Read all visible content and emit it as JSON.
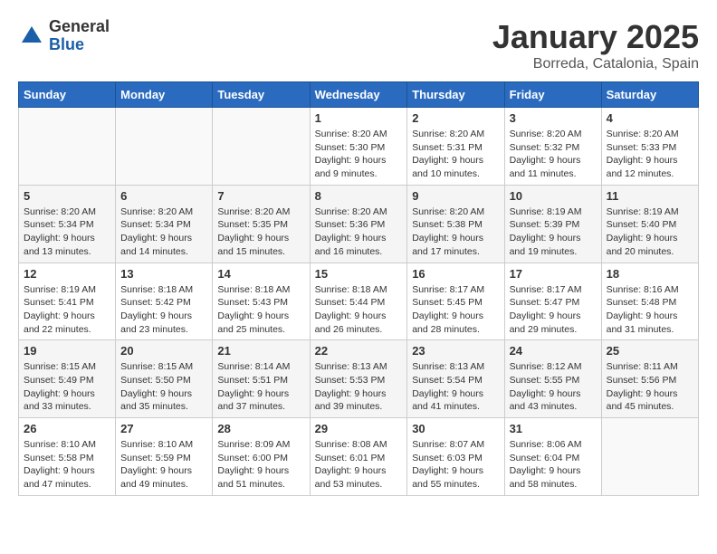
{
  "header": {
    "logo_general": "General",
    "logo_blue": "Blue",
    "month_year": "January 2025",
    "location": "Borreda, Catalonia, Spain"
  },
  "days_of_week": [
    "Sunday",
    "Monday",
    "Tuesday",
    "Wednesday",
    "Thursday",
    "Friday",
    "Saturday"
  ],
  "weeks": [
    [
      {
        "day": "",
        "sunrise": "",
        "sunset": "",
        "daylight": ""
      },
      {
        "day": "",
        "sunrise": "",
        "sunset": "",
        "daylight": ""
      },
      {
        "day": "",
        "sunrise": "",
        "sunset": "",
        "daylight": ""
      },
      {
        "day": "1",
        "sunrise": "Sunrise: 8:20 AM",
        "sunset": "Sunset: 5:30 PM",
        "daylight": "Daylight: 9 hours and 9 minutes."
      },
      {
        "day": "2",
        "sunrise": "Sunrise: 8:20 AM",
        "sunset": "Sunset: 5:31 PM",
        "daylight": "Daylight: 9 hours and 10 minutes."
      },
      {
        "day": "3",
        "sunrise": "Sunrise: 8:20 AM",
        "sunset": "Sunset: 5:32 PM",
        "daylight": "Daylight: 9 hours and 11 minutes."
      },
      {
        "day": "4",
        "sunrise": "Sunrise: 8:20 AM",
        "sunset": "Sunset: 5:33 PM",
        "daylight": "Daylight: 9 hours and 12 minutes."
      }
    ],
    [
      {
        "day": "5",
        "sunrise": "Sunrise: 8:20 AM",
        "sunset": "Sunset: 5:34 PM",
        "daylight": "Daylight: 9 hours and 13 minutes."
      },
      {
        "day": "6",
        "sunrise": "Sunrise: 8:20 AM",
        "sunset": "Sunset: 5:34 PM",
        "daylight": "Daylight: 9 hours and 14 minutes."
      },
      {
        "day": "7",
        "sunrise": "Sunrise: 8:20 AM",
        "sunset": "Sunset: 5:35 PM",
        "daylight": "Daylight: 9 hours and 15 minutes."
      },
      {
        "day": "8",
        "sunrise": "Sunrise: 8:20 AM",
        "sunset": "Sunset: 5:36 PM",
        "daylight": "Daylight: 9 hours and 16 minutes."
      },
      {
        "day": "9",
        "sunrise": "Sunrise: 8:20 AM",
        "sunset": "Sunset: 5:38 PM",
        "daylight": "Daylight: 9 hours and 17 minutes."
      },
      {
        "day": "10",
        "sunrise": "Sunrise: 8:19 AM",
        "sunset": "Sunset: 5:39 PM",
        "daylight": "Daylight: 9 hours and 19 minutes."
      },
      {
        "day": "11",
        "sunrise": "Sunrise: 8:19 AM",
        "sunset": "Sunset: 5:40 PM",
        "daylight": "Daylight: 9 hours and 20 minutes."
      }
    ],
    [
      {
        "day": "12",
        "sunrise": "Sunrise: 8:19 AM",
        "sunset": "Sunset: 5:41 PM",
        "daylight": "Daylight: 9 hours and 22 minutes."
      },
      {
        "day": "13",
        "sunrise": "Sunrise: 8:18 AM",
        "sunset": "Sunset: 5:42 PM",
        "daylight": "Daylight: 9 hours and 23 minutes."
      },
      {
        "day": "14",
        "sunrise": "Sunrise: 8:18 AM",
        "sunset": "Sunset: 5:43 PM",
        "daylight": "Daylight: 9 hours and 25 minutes."
      },
      {
        "day": "15",
        "sunrise": "Sunrise: 8:18 AM",
        "sunset": "Sunset: 5:44 PM",
        "daylight": "Daylight: 9 hours and 26 minutes."
      },
      {
        "day": "16",
        "sunrise": "Sunrise: 8:17 AM",
        "sunset": "Sunset: 5:45 PM",
        "daylight": "Daylight: 9 hours and 28 minutes."
      },
      {
        "day": "17",
        "sunrise": "Sunrise: 8:17 AM",
        "sunset": "Sunset: 5:47 PM",
        "daylight": "Daylight: 9 hours and 29 minutes."
      },
      {
        "day": "18",
        "sunrise": "Sunrise: 8:16 AM",
        "sunset": "Sunset: 5:48 PM",
        "daylight": "Daylight: 9 hours and 31 minutes."
      }
    ],
    [
      {
        "day": "19",
        "sunrise": "Sunrise: 8:15 AM",
        "sunset": "Sunset: 5:49 PM",
        "daylight": "Daylight: 9 hours and 33 minutes."
      },
      {
        "day": "20",
        "sunrise": "Sunrise: 8:15 AM",
        "sunset": "Sunset: 5:50 PM",
        "daylight": "Daylight: 9 hours and 35 minutes."
      },
      {
        "day": "21",
        "sunrise": "Sunrise: 8:14 AM",
        "sunset": "Sunset: 5:51 PM",
        "daylight": "Daylight: 9 hours and 37 minutes."
      },
      {
        "day": "22",
        "sunrise": "Sunrise: 8:13 AM",
        "sunset": "Sunset: 5:53 PM",
        "daylight": "Daylight: 9 hours and 39 minutes."
      },
      {
        "day": "23",
        "sunrise": "Sunrise: 8:13 AM",
        "sunset": "Sunset: 5:54 PM",
        "daylight": "Daylight: 9 hours and 41 minutes."
      },
      {
        "day": "24",
        "sunrise": "Sunrise: 8:12 AM",
        "sunset": "Sunset: 5:55 PM",
        "daylight": "Daylight: 9 hours and 43 minutes."
      },
      {
        "day": "25",
        "sunrise": "Sunrise: 8:11 AM",
        "sunset": "Sunset: 5:56 PM",
        "daylight": "Daylight: 9 hours and 45 minutes."
      }
    ],
    [
      {
        "day": "26",
        "sunrise": "Sunrise: 8:10 AM",
        "sunset": "Sunset: 5:58 PM",
        "daylight": "Daylight: 9 hours and 47 minutes."
      },
      {
        "day": "27",
        "sunrise": "Sunrise: 8:10 AM",
        "sunset": "Sunset: 5:59 PM",
        "daylight": "Daylight: 9 hours and 49 minutes."
      },
      {
        "day": "28",
        "sunrise": "Sunrise: 8:09 AM",
        "sunset": "Sunset: 6:00 PM",
        "daylight": "Daylight: 9 hours and 51 minutes."
      },
      {
        "day": "29",
        "sunrise": "Sunrise: 8:08 AM",
        "sunset": "Sunset: 6:01 PM",
        "daylight": "Daylight: 9 hours and 53 minutes."
      },
      {
        "day": "30",
        "sunrise": "Sunrise: 8:07 AM",
        "sunset": "Sunset: 6:03 PM",
        "daylight": "Daylight: 9 hours and 55 minutes."
      },
      {
        "day": "31",
        "sunrise": "Sunrise: 8:06 AM",
        "sunset": "Sunset: 6:04 PM",
        "daylight": "Daylight: 9 hours and 58 minutes."
      },
      {
        "day": "",
        "sunrise": "",
        "sunset": "",
        "daylight": ""
      }
    ]
  ]
}
